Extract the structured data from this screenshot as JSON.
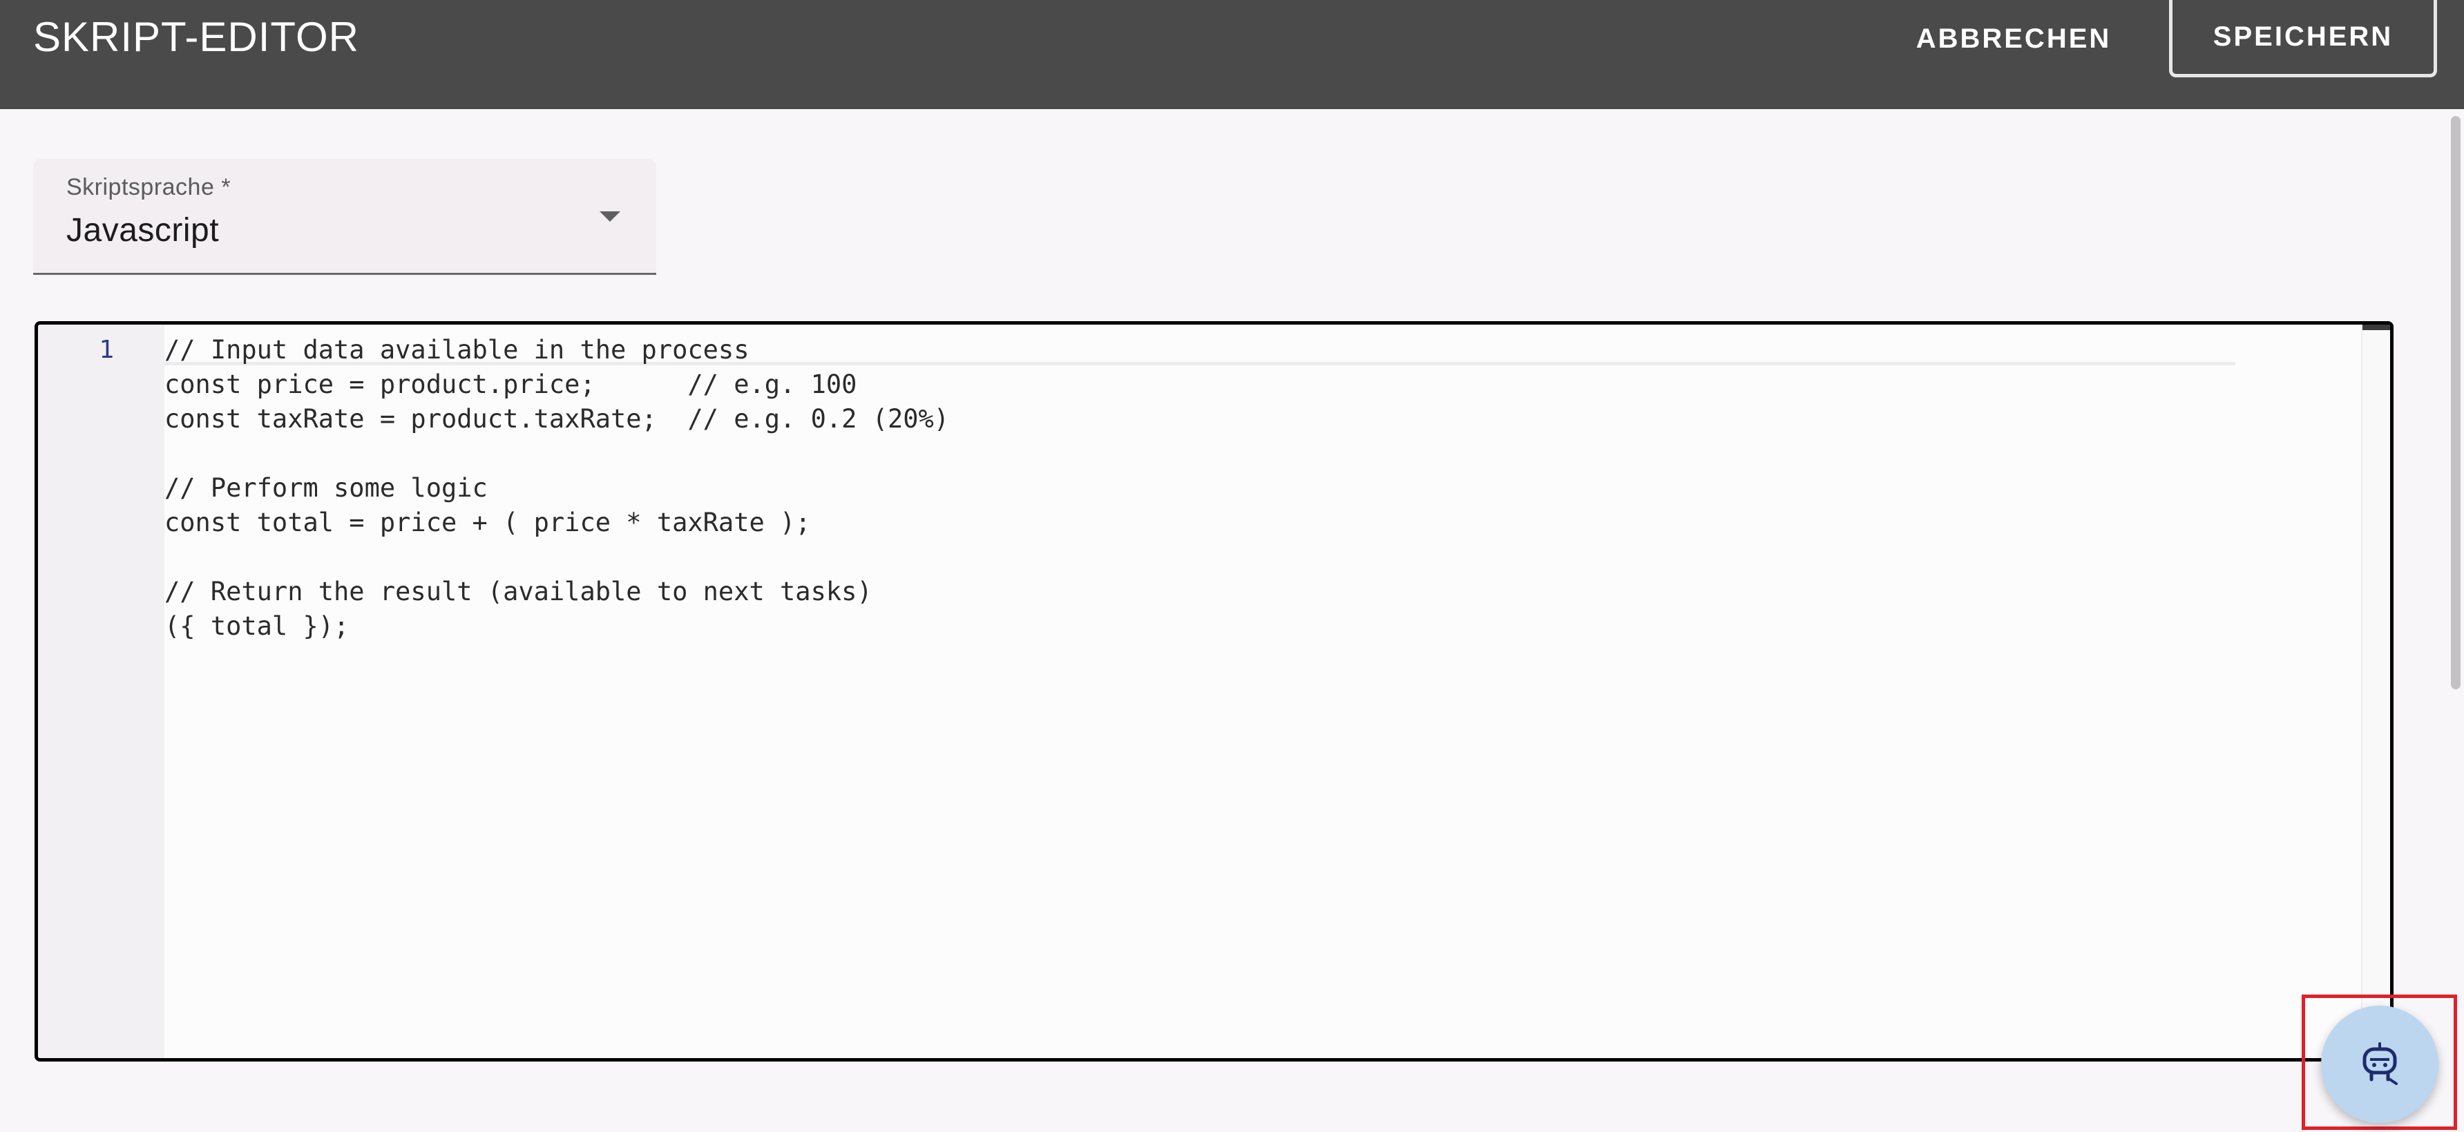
{
  "header": {
    "title": "SKRIPT-EDITOR",
    "cancel_label": "ABBRECHEN",
    "save_label": "SPEICHERN"
  },
  "language_select": {
    "label": "Skriptsprache *",
    "value": "Javascript"
  },
  "editor": {
    "line_numbers": [
      "1"
    ],
    "lines": [
      "// Input data available in the process",
      "const price = product.price;      // e.g. 100",
      "const taxRate = product.taxRate;  // e.g. 0.2 (20%)",
      "",
      "// Perform some logic",
      "const total = price + ( price * taxRate );",
      "",
      "// Return the result (available to next tasks)",
      "({ total });"
    ]
  },
  "assistant_button": {
    "icon": "robot-assistant-icon"
  },
  "colors": {
    "header_bg": "#4a4a4a",
    "highlight_border": "#e0202a",
    "fab_bg": "#bcd6f0",
    "line_number": "#2a3a8a"
  }
}
